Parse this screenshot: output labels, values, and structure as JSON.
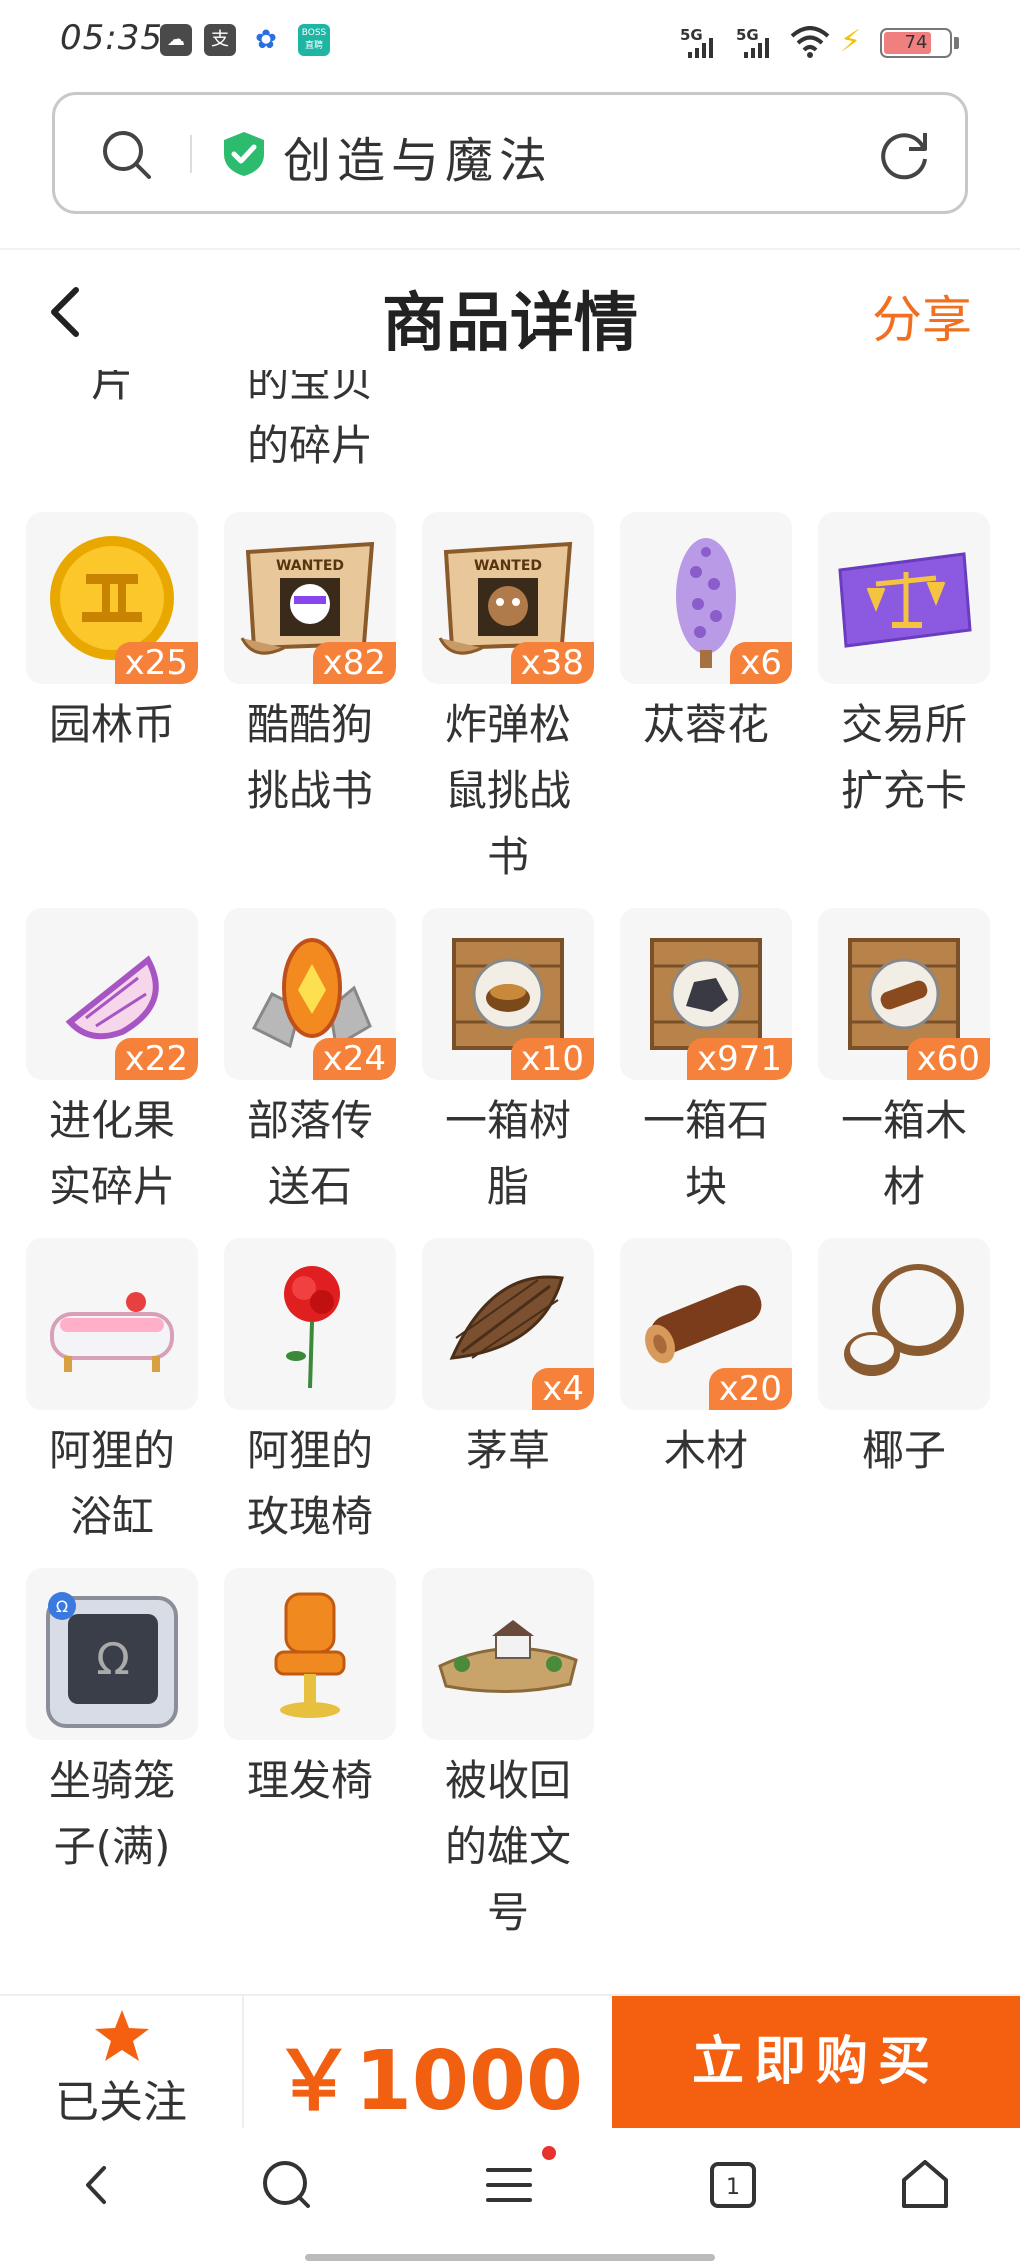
{
  "status_bar": {
    "time": "05:35",
    "app_icons": [
      "app-icon",
      "alipay-icon",
      "baidu-icon",
      "boss-icon"
    ],
    "boss_label": "BOSS\n直聘",
    "signal_1": "5G",
    "signal_2": "5G",
    "battery": "74"
  },
  "address_bar": {
    "text": "创造与魔法",
    "secure_color": "#2dbb6e"
  },
  "header": {
    "title": "商品详情",
    "share_label": "分享"
  },
  "partial_row": {
    "labels": [
      "片",
      "的宝贝\n的碎片"
    ]
  },
  "items": [
    {
      "name": "园林币",
      "qty": "x25",
      "icon": "coin-icon"
    },
    {
      "name": "酷酷狗\n挑战书",
      "qty": "x82",
      "icon": "wanted-scroll-dog-icon"
    },
    {
      "name": "炸弹松\n鼠挑战\n书",
      "qty": "x38",
      "icon": "wanted-scroll-squirrel-icon"
    },
    {
      "name": "苁蓉花",
      "qty": "x6",
      "icon": "purple-flower-icon"
    },
    {
      "name": "交易所\n扩充卡",
      "qty": "",
      "icon": "scale-card-icon"
    },
    {
      "name": "进化果\n实碎片",
      "qty": "x22",
      "icon": "fruit-fragment-icon"
    },
    {
      "name": "部落传\n送石",
      "qty": "x24",
      "icon": "teleport-stone-icon"
    },
    {
      "name": "一箱树\n脂",
      "qty": "x10",
      "icon": "resin-crate-icon"
    },
    {
      "name": "一箱石\n块",
      "qty": "x971",
      "icon": "stone-crate-icon"
    },
    {
      "name": "一箱木\n材",
      "qty": "x60",
      "icon": "wood-crate-icon"
    },
    {
      "name": "阿狸的\n浴缸",
      "qty": "",
      "icon": "bathtub-icon"
    },
    {
      "name": "阿狸的\n玫瑰椅",
      "qty": "",
      "icon": "rose-chair-icon"
    },
    {
      "name": "茅草",
      "qty": "x4",
      "icon": "thatch-icon"
    },
    {
      "name": "木材",
      "qty": "x20",
      "icon": "log-icon"
    },
    {
      "name": "椰子",
      "qty": "",
      "icon": "coconut-icon"
    },
    {
      "name": "坐骑笼\n子(满)",
      "qty": "",
      "icon": "mount-cage-icon"
    },
    {
      "name": "理发椅",
      "qty": "",
      "icon": "barber-chair-icon"
    },
    {
      "name": "被收回\n的雄文\n号",
      "qty": "",
      "icon": "ship-wreck-icon"
    }
  ],
  "purchase_bar": {
    "follow_label": "已关注",
    "price": "￥1000",
    "buy_label": "立即购买",
    "accent_color": "#f46010"
  },
  "system_nav": {
    "buttons": [
      "back-icon",
      "search-icon",
      "menu-icon",
      "tabs-icon",
      "home-icon"
    ],
    "tabs_count": "1"
  }
}
